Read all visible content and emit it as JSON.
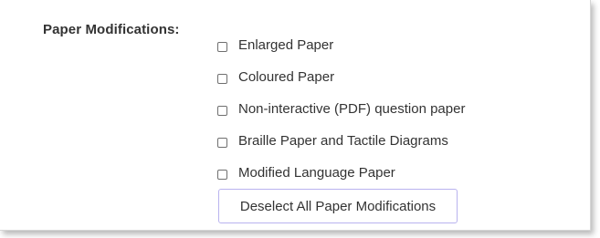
{
  "paper_modifications": {
    "label": "Paper Modifications:",
    "options": [
      {
        "label": "Enlarged Paper",
        "checked": false
      },
      {
        "label": "Coloured Paper",
        "checked": false
      },
      {
        "label": "Non-interactive (PDF) question paper",
        "checked": false
      },
      {
        "label": "Braille Paper and Tactile Diagrams",
        "checked": false
      },
      {
        "label": "Modified Language Paper",
        "checked": false
      }
    ],
    "deselect_button_label": "Deselect All Paper Modifications"
  }
}
